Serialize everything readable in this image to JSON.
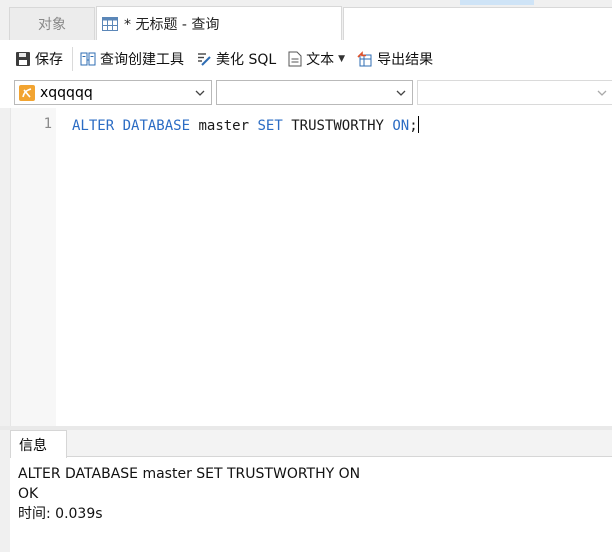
{
  "tabs": {
    "objects_label": "对象",
    "query_label": "* 无标题 - 查询"
  },
  "toolbar": {
    "save_label": "保存",
    "query_builder_label": "查询创建工具",
    "beautify_label": "美化 SQL",
    "text_label": "文本",
    "export_label": "导出结果"
  },
  "selectors": {
    "connection": "xqqqqq",
    "database": "",
    "schema": ""
  },
  "editor": {
    "line_numbers": [
      "1"
    ],
    "tokens": {
      "t1": "ALTER",
      "t2": "DATABASE",
      "t3": "master",
      "t4": "SET",
      "t5": "TRUSTWORTHY",
      "t6": "ON",
      "t7": ";"
    }
  },
  "result": {
    "tab_label": "信息",
    "lines": [
      "ALTER DATABASE master SET TRUSTWORTHY ON",
      "OK",
      "时间: 0.039s"
    ]
  },
  "colors": {
    "keyword": "#2b6cc4",
    "background": "#f0f0f0",
    "panel": "#ffffff",
    "connection_icon": "#f2a431"
  },
  "icons": {
    "query_tab": "table-icon",
    "save": "save-icon",
    "query_builder": "query-builder-icon",
    "beautify": "beautify-sql-icon",
    "text": "text-document-icon",
    "export": "export-results-icon",
    "connection": "mssql-connection-icon",
    "dropdown": "chevron-down-icon"
  }
}
